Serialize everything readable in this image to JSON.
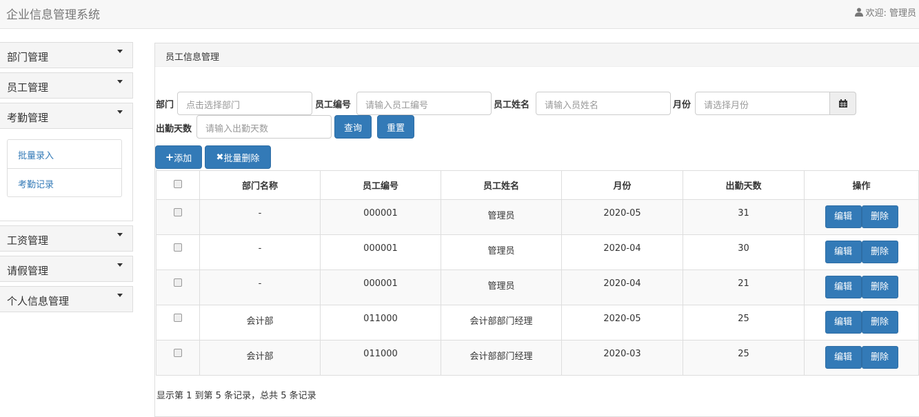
{
  "app": {
    "title": "企业信息管理系统",
    "welcome": "欢迎: 管理员"
  },
  "sidebar": {
    "menus": [
      {
        "label": "部门管理"
      },
      {
        "label": "员工管理"
      },
      {
        "label": "考勤管理",
        "sub": [
          "批量录入",
          "考勤记录"
        ]
      },
      {
        "label": "工资管理"
      },
      {
        "label": "请假管理"
      },
      {
        "label": "个人信息管理"
      }
    ]
  },
  "panel": {
    "title": "员工信息管理"
  },
  "filters": {
    "dept": {
      "label": "部门",
      "placeholder": "点击选择部门"
    },
    "empno": {
      "label": "员工编号",
      "placeholder": "请输入员工编号"
    },
    "name": {
      "label": "员工姓名",
      "placeholder": "请输入员姓名"
    },
    "month": {
      "label": "月份",
      "placeholder": "请选择月份"
    },
    "days": {
      "label": "出勤天数",
      "placeholder": "请输入出勤天数"
    },
    "query": "查询",
    "reset": "重置"
  },
  "toolbar": {
    "add": "添加",
    "batch_delete": "批量删除"
  },
  "table": {
    "headers": [
      "部门名称",
      "员工编号",
      "员工姓名",
      "月份",
      "出勤天数",
      "操作"
    ],
    "rows": [
      [
        "-",
        "000001",
        "管理员",
        "2020-05",
        "31"
      ],
      [
        "-",
        "000001",
        "管理员",
        "2020-04",
        "30"
      ],
      [
        "-",
        "000001",
        "管理员",
        "2020-04",
        "21"
      ],
      [
        "会计部",
        "011000",
        "会计部部门经理",
        "2020-05",
        "25"
      ],
      [
        "会计部",
        "011000",
        "会计部部门经理",
        "2020-03",
        "25"
      ]
    ],
    "edit": "编辑",
    "delete": "删除"
  },
  "footer": "显示第 1 到第 5 条记录，总共 5 条记录"
}
